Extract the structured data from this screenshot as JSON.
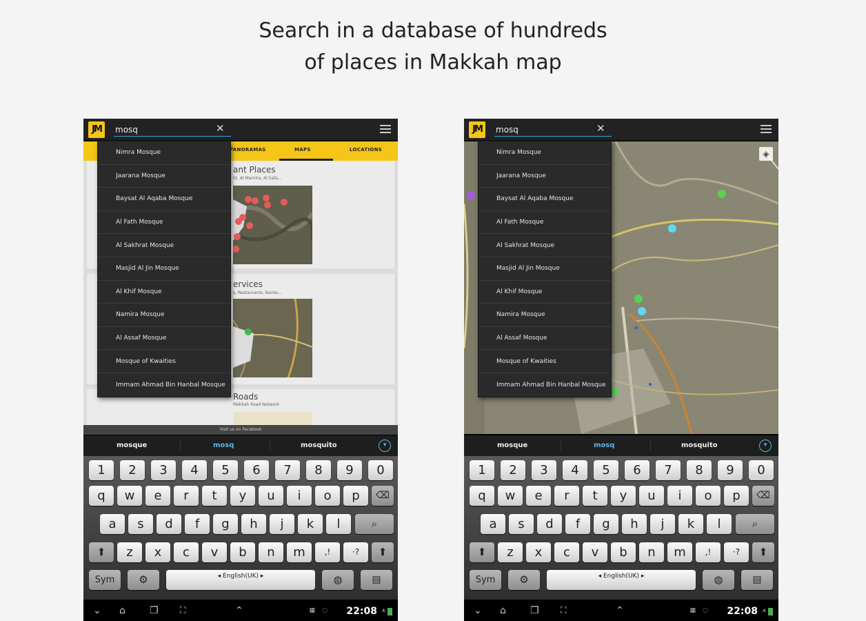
{
  "headline": {
    "line1": "Search in a database of hundreds",
    "line2": "of places in Makkah map"
  },
  "app": {
    "logo": "JM",
    "search_query": "mosq",
    "clear_icon": "close-icon",
    "filter_icon": "filter-icon"
  },
  "tabs": [
    {
      "label": "PANORAMAS"
    },
    {
      "label": "MAPS",
      "selected": true
    },
    {
      "label": "LOCATIONS"
    }
  ],
  "cards": [
    {
      "title": "ant Places",
      "subtitle": "ht, Al Mamlra, Al Safa..."
    },
    {
      "title": "ervices",
      "subtitle": "s, Restaurants, Banks..."
    },
    {
      "title": "Roads",
      "subtitle": "Makkah Road Network"
    }
  ],
  "facebook_bar": "Visit us on Facebook",
  "suggestions": [
    "Nimra Mosque",
    "Jaarana Mosque",
    "Baysat Al Aqaba Mosque",
    "Al Fath Mosque",
    "Al Sakhrat Mosque",
    "Masjid Al Jin Mosque",
    "Al Khif Mosque",
    "Namira Mosque",
    "Al Assaf Mosque",
    "Mosque of Kwaities",
    "Immam Ahmad Bin Hanbal Mosque"
  ],
  "word_suggestions": [
    "mosque",
    "mosq",
    "mosquito"
  ],
  "keyboard": {
    "row1": [
      "1",
      "2",
      "3",
      "4",
      "5",
      "6",
      "7",
      "8",
      "9",
      "0"
    ],
    "row2": [
      "q",
      "w",
      "e",
      "r",
      "t",
      "y",
      "u",
      "i",
      "o",
      "p"
    ],
    "row3": [
      "a",
      "s",
      "d",
      "f",
      "g",
      "h",
      "j",
      "k",
      "l"
    ],
    "row4": [
      "z",
      "x",
      "c",
      "v",
      "b",
      "n",
      "m",
      ",!",
      "·?"
    ],
    "sym": "Sym",
    "space": "◂ English(UK) ▸",
    "backspace_icon": "backspace-icon",
    "search_icon": "search-icon",
    "shift_icon": "shift-icon",
    "settings_icon": "gear-icon",
    "globe_icon": "globe-icon",
    "clipboard_icon": "clipboard-icon"
  },
  "status": {
    "time": "22:08"
  },
  "colors": {
    "accent": "#f5c518",
    "highlight": "#2aa6d6",
    "suggestion_selected": "#5ab8e8"
  }
}
